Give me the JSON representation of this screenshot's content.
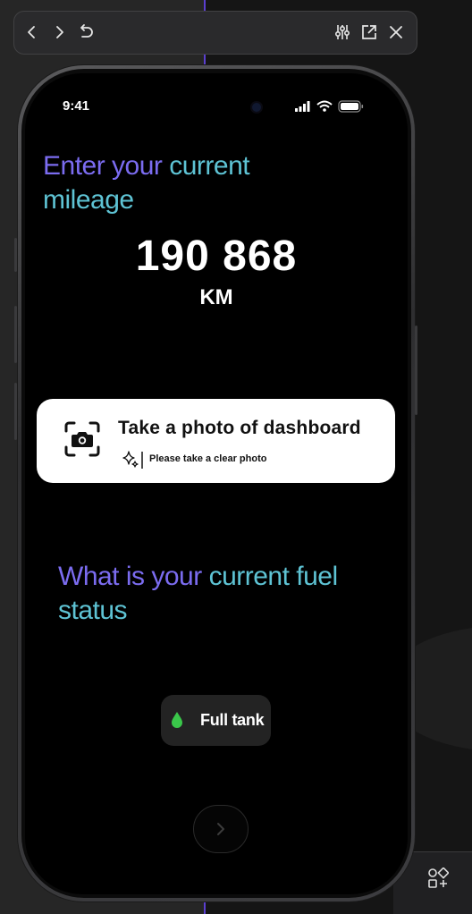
{
  "browser": {
    "icons": [
      "chevron-left-icon",
      "chevron-right-icon",
      "refresh-icon",
      "sliders-icon",
      "open-external-icon",
      "close-icon"
    ]
  },
  "status_bar": {
    "time": "9:41",
    "icons": [
      "signal-icon",
      "wifi-icon",
      "battery-icon"
    ]
  },
  "mileage": {
    "heading_part1": "Enter your ",
    "heading_part2": "current mileage",
    "value": "190 868",
    "unit": "KM"
  },
  "photo_card": {
    "title": "Take a photo of dashboard",
    "subtitle": "Please take a clear photo"
  },
  "fuel": {
    "heading_part1": "What is your ",
    "heading_part2": "current fuel status",
    "chip_label": "Full tank",
    "chip_color": "#3ac74a"
  },
  "colors": {
    "heading_purple": "#7b6cf0",
    "heading_teal": "#5ec3d4"
  }
}
